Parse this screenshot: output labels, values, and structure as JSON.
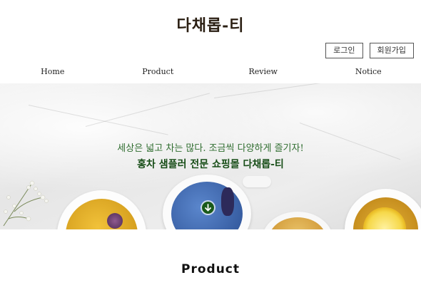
{
  "header": {
    "logo": "다채롭-티"
  },
  "auth": {
    "login_label": "로그인",
    "signup_label": "회원가입"
  },
  "nav": {
    "items": [
      "Home",
      "Product",
      "Review",
      "Notice"
    ]
  },
  "hero": {
    "line1": "세상은 넓고 차는 많다. 조금씩 다양하게 즐기자!",
    "line2": "홍차 샘플러 전문 쇼핑몰 다채롭-티"
  },
  "section": {
    "title": "Product"
  }
}
